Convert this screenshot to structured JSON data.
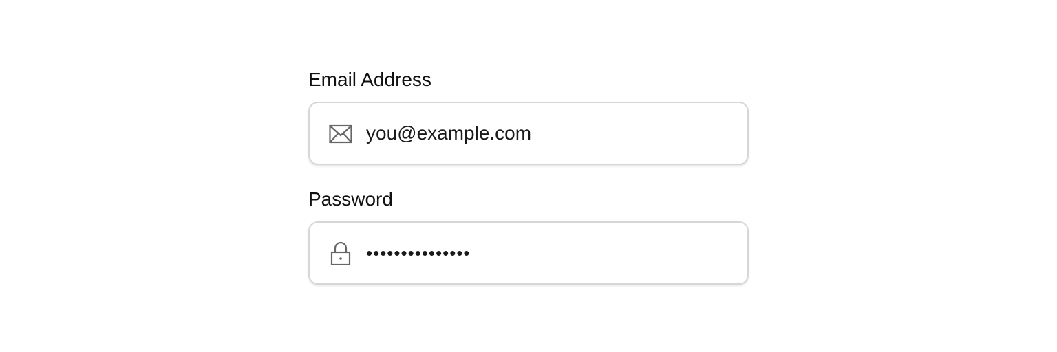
{
  "form": {
    "email": {
      "label": "Email Address",
      "value": "you@example.com",
      "icon": "mail-icon"
    },
    "password": {
      "label": "Password",
      "value": "•••••••••••••••",
      "icon": "lock-icon"
    }
  },
  "colors": {
    "background": "#ffffff",
    "border": "#d6d6d6",
    "text": "#111111",
    "icon": "#666666"
  }
}
